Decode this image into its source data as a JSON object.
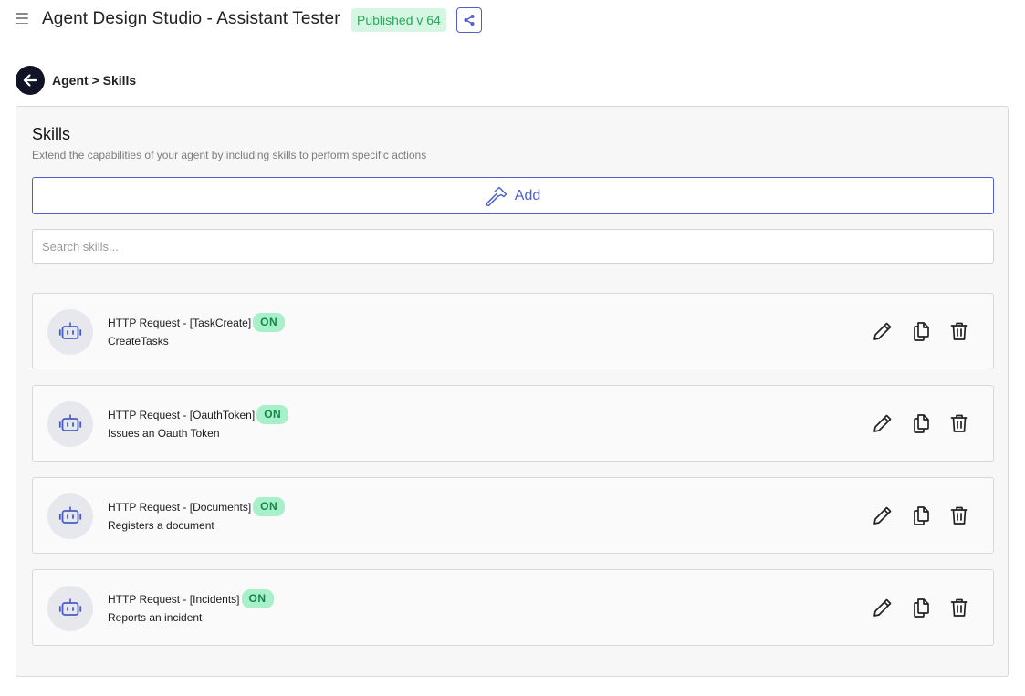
{
  "header": {
    "app_title": "Agent Design Studio - Assistant Tester",
    "published_badge": "Published v 64"
  },
  "breadcrumb": "Agent > Skills",
  "panel": {
    "title": "Skills",
    "subtitle": "Extend the capabilities of your agent by including skills to perform specific actions",
    "add_label": "Add",
    "search_placeholder": "Search skills..."
  },
  "skills": [
    {
      "name": "HTTP Request - [TaskCreate]",
      "status": "ON",
      "description": "CreateTasks"
    },
    {
      "name": "HTTP Request - [OauthToken]",
      "status": "ON",
      "description": "Issues an Oauth Token"
    },
    {
      "name": "HTTP Request - [Documents]",
      "status": "ON",
      "description": "Registers a document"
    },
    {
      "name": "HTTP Request - [Incidents]",
      "status": "ON",
      "description": "Reports an incident"
    }
  ],
  "icons": {
    "menu": "menu-icon",
    "share": "share-icon",
    "back": "arrow-left-icon",
    "add": "hammer-icon",
    "skill": "robot-icon",
    "edit": "pencil-icon",
    "duplicate": "copy-icon",
    "delete": "trash-icon"
  },
  "colors": {
    "accent": "#4f5fd0",
    "published_bg": "#d5f6e3",
    "published_text": "#2aa85c",
    "on_bg": "#a7f0c9",
    "on_text": "#17854a",
    "back_button": "#101426"
  }
}
